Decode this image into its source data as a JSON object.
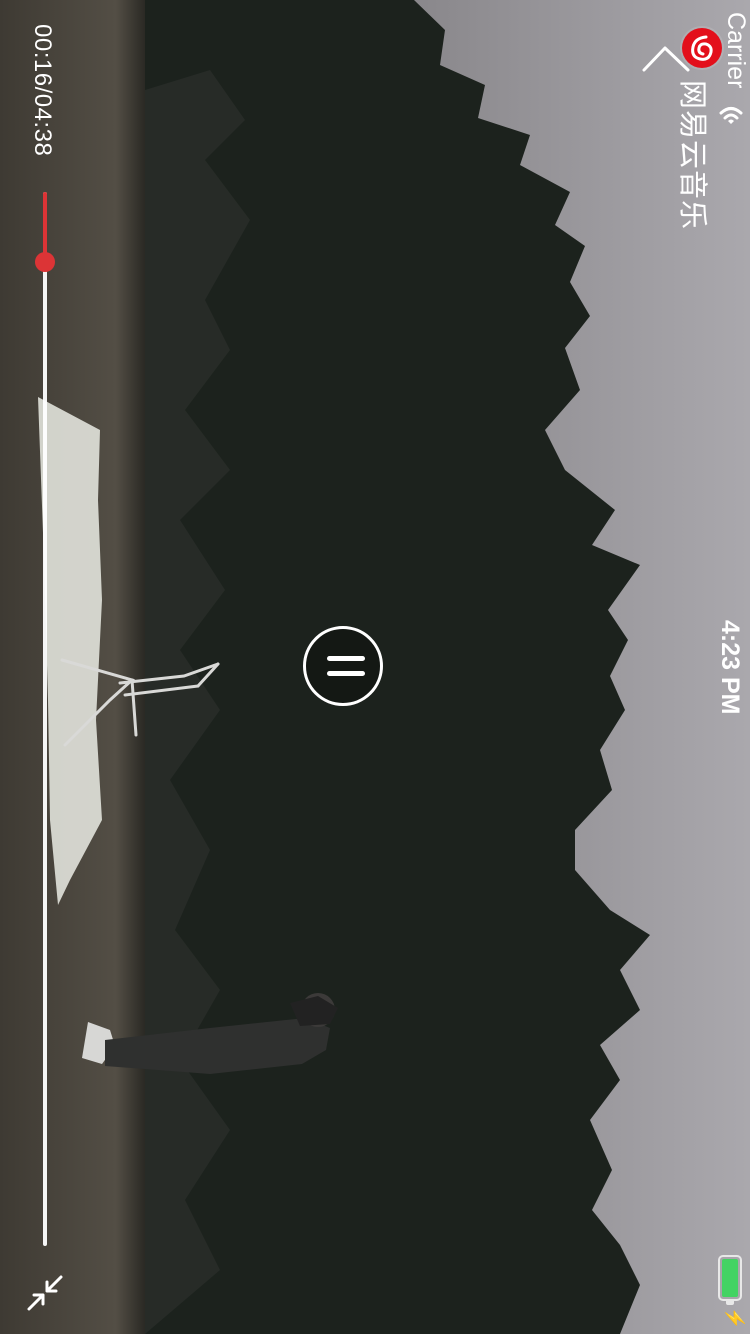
{
  "status_bar": {
    "carrier": "Carrier",
    "time": "4:23 PM",
    "charging_glyph": "⚡",
    "wifi_icon": "wifi-icon",
    "battery_icon": "battery-icon",
    "battery_color": "#43d363"
  },
  "header": {
    "back_icon": "back-chevron-icon",
    "brand_icon": "netease-cloud-music-logo-icon",
    "brand_name": "网易云音乐",
    "brand_color": "#e30f1b"
  },
  "player": {
    "control_icon": "pause-icon",
    "current_time": "00:16",
    "separator": "/",
    "duration": "04:38",
    "progress": 0.066,
    "progress_color": "#dc3436",
    "fullscreen_icon": "exit-fullscreen-icon"
  }
}
